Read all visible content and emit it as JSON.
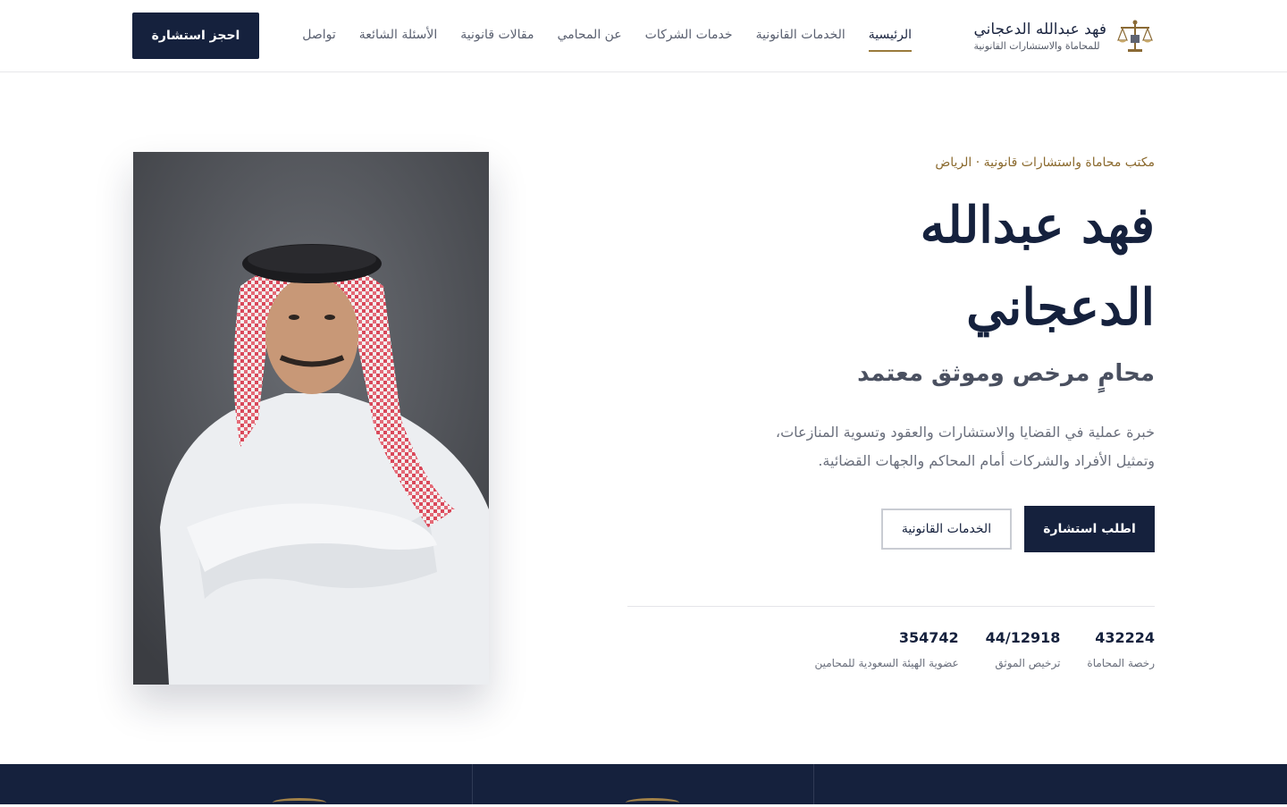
{
  "brand": {
    "name": "فهد عبدالله الدعجاني",
    "subtitle": "للمحاماة والاستشارات القانونية",
    "logo_icon": "scales-of-justice-icon"
  },
  "nav": {
    "items": [
      {
        "label": "الرئيسية",
        "active": true
      },
      {
        "label": "الخدمات القانونية",
        "active": false
      },
      {
        "label": "خدمات الشركات",
        "active": false
      },
      {
        "label": "عن المحامي",
        "active": false
      },
      {
        "label": "مقالات قانونية",
        "active": false
      },
      {
        "label": "الأسئلة الشائعة",
        "active": false
      },
      {
        "label": "تواصل",
        "active": false
      }
    ],
    "book_label": "احجز استشارة"
  },
  "hero": {
    "eyebrow": "مكتب محاماة واستشارات قانونية · الرياض",
    "name_line1": "فهد عبدالله",
    "name_line2": "الدعجاني",
    "title": "محامٍ مرخص وموثق معتمد",
    "description": "خبرة عملية في القضايا والاستشارات والعقود وتسوية المنازعات، وتمثيل الأفراد والشركات أمام المحاكم والجهات القضائية.",
    "primary_button": "اطلب استشارة",
    "secondary_button": "الخدمات القانونية"
  },
  "stats": [
    {
      "value": "432224",
      "label": "رخصة المحاماة"
    },
    {
      "value": "44/12918",
      "label": "ترخيص الموثق"
    },
    {
      "value": "354742",
      "label": "عضوية الهيئة السعودية للمحامين"
    }
  ],
  "colors": {
    "navy": "#15213d",
    "gold": "#9a7a3b",
    "text_muted": "#6a6f7c"
  }
}
